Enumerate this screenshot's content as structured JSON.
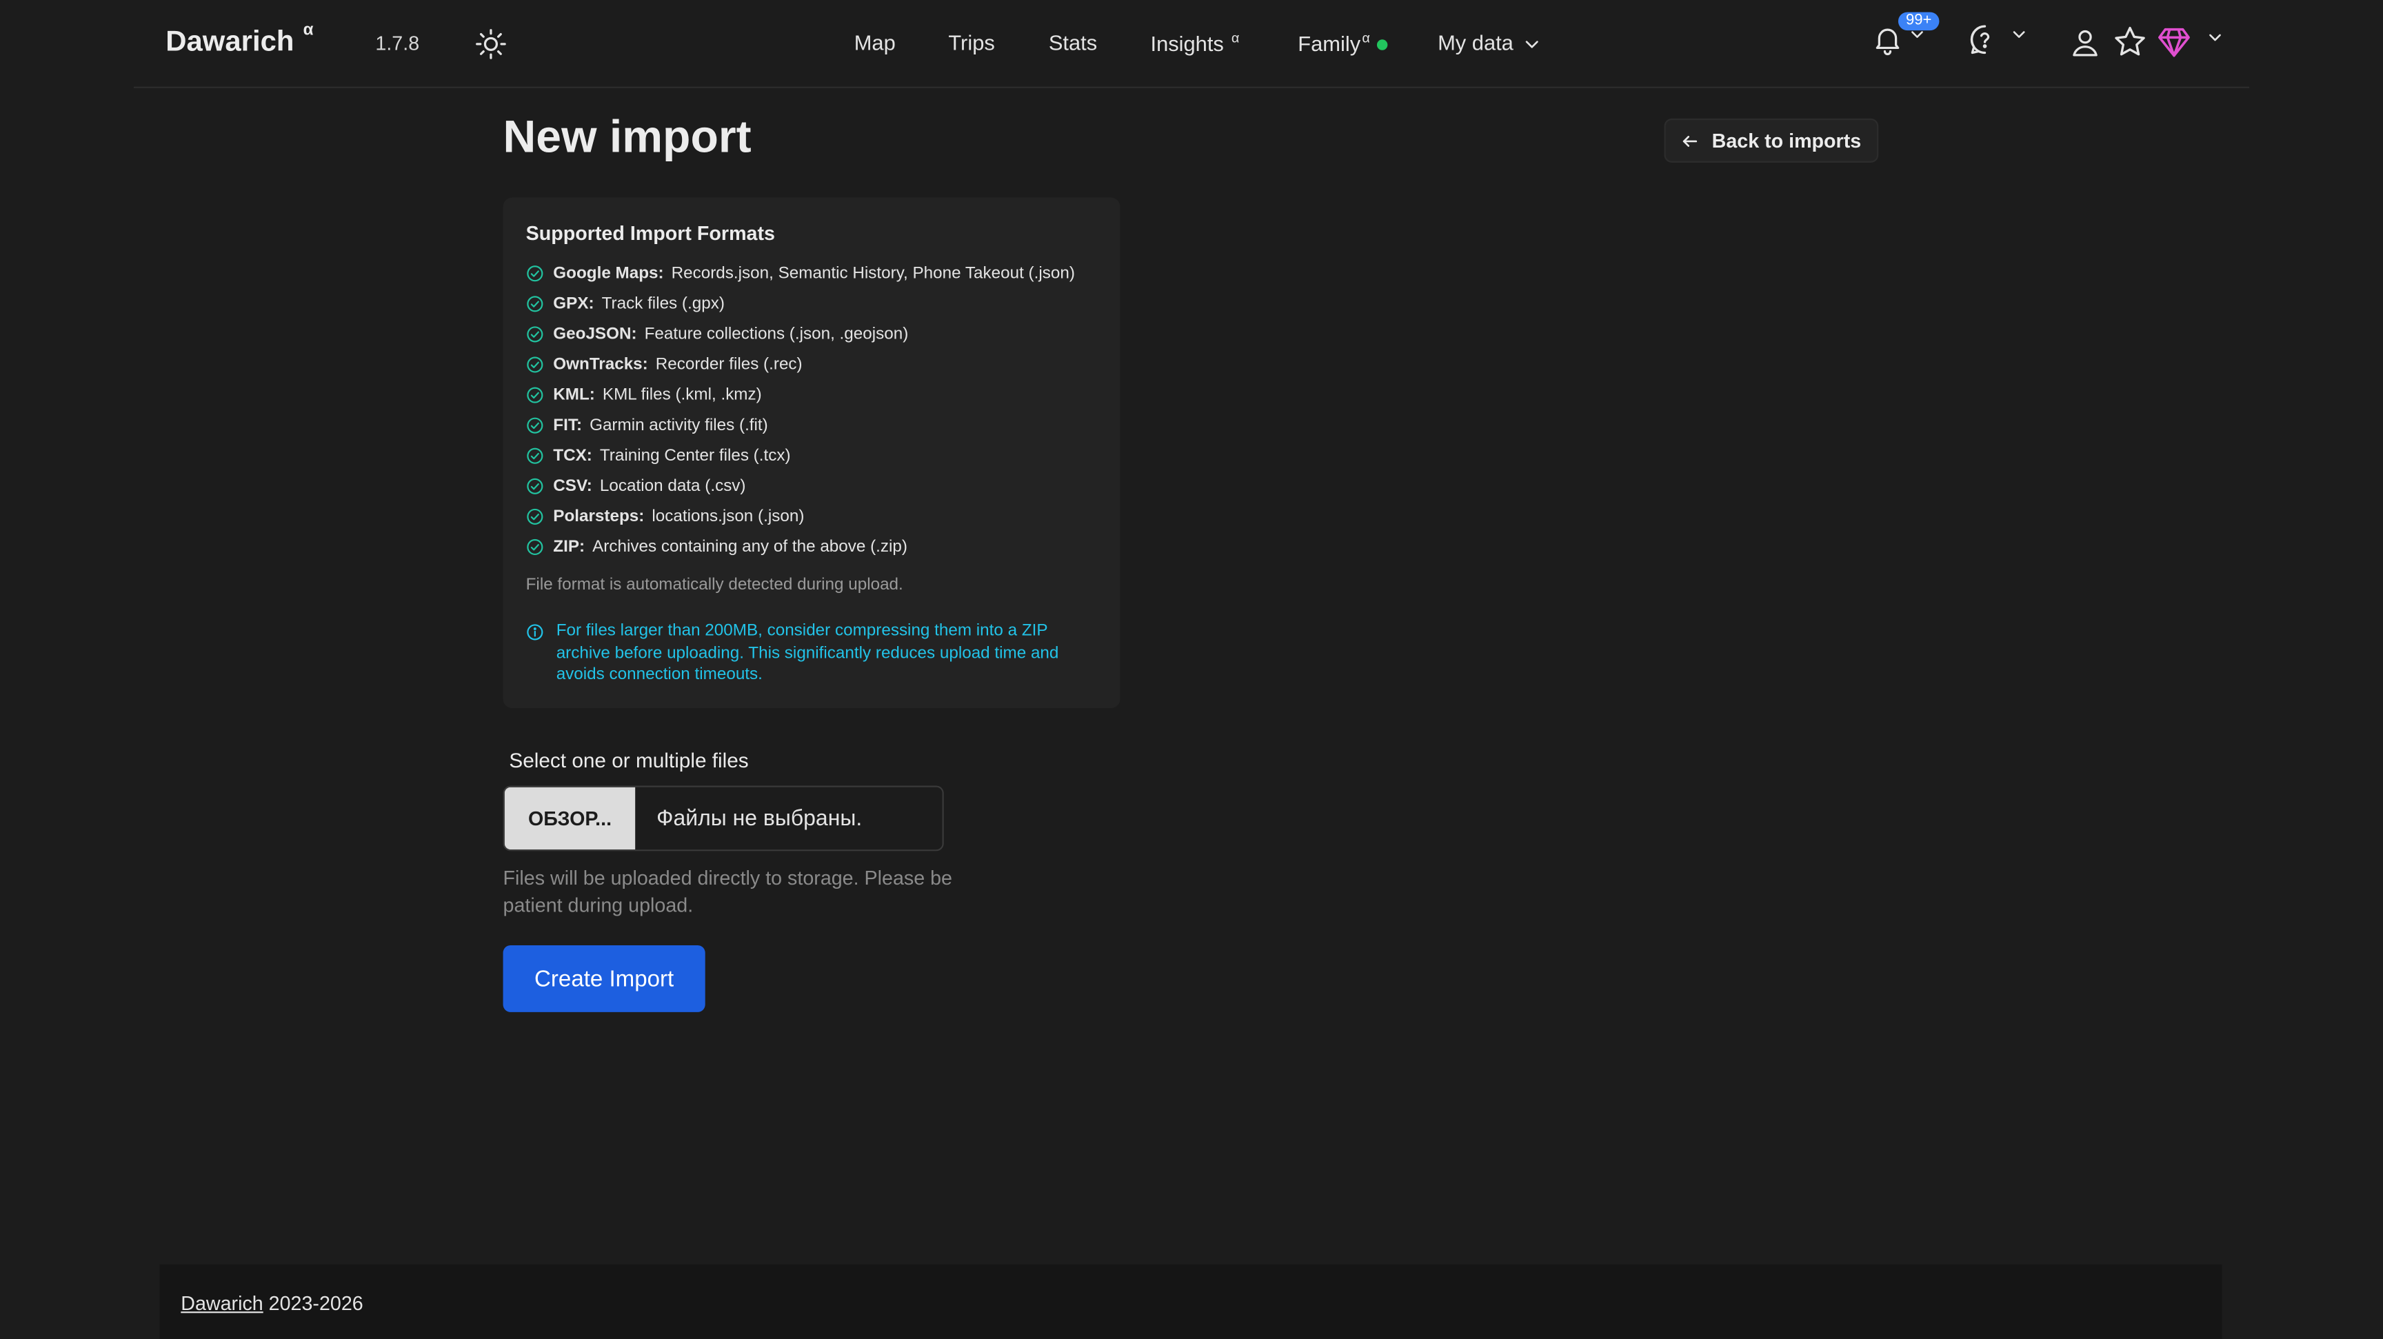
{
  "navbar": {
    "brand": "Dawarich",
    "brand_sup": "α",
    "version": "1.7.8",
    "links": {
      "map": "Map",
      "trips": "Trips",
      "stats": "Stats",
      "insights": "Insights",
      "insights_sup": "α",
      "family": "Family",
      "family_sup": "α",
      "my_data": "My data"
    },
    "notifications_badge": "99+",
    "icons": {
      "theme": "sun-icon",
      "notifications": "bell-icon",
      "help": "help-circle-icon",
      "user": "user-icon",
      "favorites": "star-icon",
      "plan": "gem-icon"
    },
    "colors": {
      "online_dot": "#22c55e",
      "badge": "#3b82f6",
      "gem": "#e04fd0"
    }
  },
  "main": {
    "title": "New import",
    "back_button": "Back to imports",
    "formats": {
      "title": "Supported Import Formats",
      "items": [
        {
          "name": "Google Maps:",
          "desc": "Records.json, Semantic History, Phone Takeout (.json)"
        },
        {
          "name": "GPX:",
          "desc": "Track files (.gpx)"
        },
        {
          "name": "GeoJSON:",
          "desc": "Feature collections (.json, .geojson)"
        },
        {
          "name": "OwnTracks:",
          "desc": "Recorder files (.rec)"
        },
        {
          "name": "KML:",
          "desc": "KML files (.kml, .kmz)"
        },
        {
          "name": "FIT:",
          "desc": "Garmin activity files (.fit)"
        },
        {
          "name": "TCX:",
          "desc": "Training Center files (.tcx)"
        },
        {
          "name": "CSV:",
          "desc": "Location data (.csv)"
        },
        {
          "name": "Polarsteps:",
          "desc": "locations.json (.json)"
        },
        {
          "name": "ZIP:",
          "desc": "Archives containing any of the above (.zip)"
        }
      ],
      "auto_note": "File format is automatically detected during upload.",
      "tip": "For files larger than 200MB, consider compressing them into a ZIP archive before uploading. This significantly reduces upload time and avoids connection timeouts.",
      "tip_color": "#22c3e8"
    },
    "file": {
      "label": "Select one or multiple files",
      "button": "ОБЗОР...",
      "status": "Файлы не выбраны.",
      "help": "Files will be uploaded directly to storage. Please be patient during upload."
    },
    "submit": "Create Import",
    "submit_color": "#1d5fe0"
  },
  "footer": {
    "link": "Dawarich",
    "years": " 2023-2026"
  }
}
